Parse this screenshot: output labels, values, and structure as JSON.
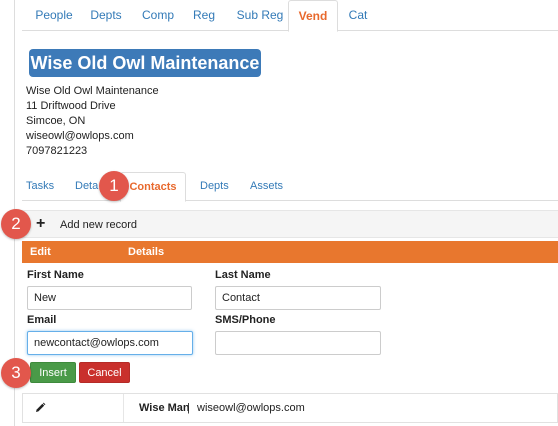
{
  "top_tabs": [
    "People",
    "Depts",
    "Comp",
    "Reg",
    "Sub Reg",
    "Vend",
    "Cat"
  ],
  "active_top_tab": "Vend",
  "vendor": {
    "title": "Wise Old Owl Maintenance",
    "name": "Wise Old Owl Maintenance",
    "address": "11 Driftwood Drive",
    "city": "Simcoe, ON",
    "email": "wiseowl@owlops.com",
    "phone": "7097821223"
  },
  "sub_tabs": [
    "Tasks",
    "Deta",
    "Contacts",
    "Depts",
    "Assets"
  ],
  "active_sub_tab": "Contacts",
  "badges": [
    "1",
    "2",
    "3"
  ],
  "add_record_label": "Add new record",
  "table_header": {
    "edit": "Edit",
    "details": "Details"
  },
  "form": {
    "first_name_label": "First Name",
    "first_name_value": "New",
    "last_name_label": "Last Name",
    "last_name_value": "Contact",
    "email_label": "Email",
    "email_value": "newcontact@owlops.com",
    "sms_label": "SMS/Phone",
    "sms_value": "",
    "insert_label": "Insert",
    "cancel_label": "Cancel"
  },
  "contacts": [
    {
      "name": "Wise Man",
      "separator": "|",
      "email": "wiseowl@owlops.com"
    }
  ],
  "colors": {
    "accent_orange": "#e8772e",
    "title_blue": "#3d7ab8",
    "link_blue": "#337ab7",
    "badge_red": "#e2574c",
    "insert_green": "#4a9a48",
    "cancel_red": "#c9302c"
  }
}
